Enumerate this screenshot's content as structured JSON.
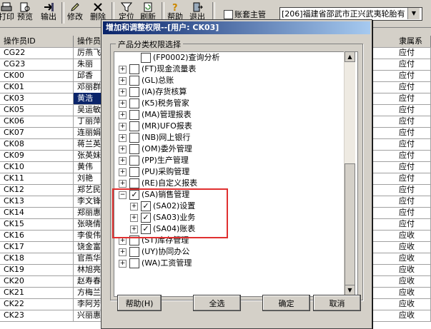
{
  "toolbar": {
    "buttons": [
      {
        "label": "打印",
        "icon": "print-icon"
      },
      {
        "label": "预览",
        "icon": "preview-icon"
      },
      {
        "label": "输出",
        "icon": "export-icon"
      },
      {
        "label": "修改",
        "icon": "edit-icon"
      },
      {
        "label": "删除",
        "icon": "delete-icon"
      },
      {
        "label": "定位",
        "icon": "filter-icon"
      },
      {
        "label": "刷新",
        "icon": "refresh-icon"
      },
      {
        "label": "帮助",
        "icon": "help-icon"
      },
      {
        "label": "退出",
        "icon": "exit-icon"
      }
    ],
    "account_checkbox_label": "账套主管",
    "company_select": "[206]福建省邵武市正兴武夷轮胎有"
  },
  "grid": {
    "headers": [
      "操作员ID",
      "操作员",
      "隶属系"
    ],
    "rows": [
      {
        "id": "CG22",
        "name": "厉燕飞",
        "dept": "应付"
      },
      {
        "id": "CG23",
        "name": "朱丽",
        "dept": "应付"
      },
      {
        "id": "CK00",
        "name": "邱香",
        "dept": "应付"
      },
      {
        "id": "CK01",
        "name": "邓丽群",
        "dept": "应付"
      },
      {
        "id": "CK03",
        "name": "黄浩",
        "dept": "应付"
      },
      {
        "id": "CK05",
        "name": "吴运敏",
        "dept": "应付"
      },
      {
        "id": "CK06",
        "name": "丁丽萍",
        "dept": "应付"
      },
      {
        "id": "CK07",
        "name": "连丽娟",
        "dept": "应付"
      },
      {
        "id": "CK08",
        "name": "蒋兰英",
        "dept": "应付"
      },
      {
        "id": "CK09",
        "name": "张英妹",
        "dept": "应付"
      },
      {
        "id": "CK10",
        "name": "黄伟",
        "dept": "应付"
      },
      {
        "id": "CK11",
        "name": "刘艳",
        "dept": "应付"
      },
      {
        "id": "CK12",
        "name": "郑艺民",
        "dept": "应付"
      },
      {
        "id": "CK13",
        "name": "李文锋",
        "dept": "应付"
      },
      {
        "id": "CK14",
        "name": "郑丽惠",
        "dept": "应付"
      },
      {
        "id": "CK15",
        "name": "张晓倩",
        "dept": "应付"
      },
      {
        "id": "CK16",
        "name": "李俊伟",
        "dept": "应收"
      },
      {
        "id": "CK17",
        "name": "饶金富",
        "dept": "应收"
      },
      {
        "id": "CK18",
        "name": "官燕华",
        "dept": "应收"
      },
      {
        "id": "CK19",
        "name": "林旭亮",
        "dept": "应收"
      },
      {
        "id": "CK20",
        "name": "赵寿春",
        "dept": "应收"
      },
      {
        "id": "CK21",
        "name": "方梅兰",
        "dept": "应收"
      },
      {
        "id": "CK22",
        "name": "李阿芳",
        "dept": "应收"
      },
      {
        "id": "CK23",
        "name": "兴丽惠",
        "dept": "应收"
      }
    ]
  },
  "dialog": {
    "title": "增加和调整权限--[用户: CK03]",
    "group_label": "产品分类权限选择",
    "tree": [
      {
        "label": "(FP0002)查询分析",
        "level": 2,
        "checked": false,
        "expander": false
      },
      {
        "label": "(FT)现金流量表",
        "level": 1,
        "checked": false,
        "expander": true
      },
      {
        "label": "(GL)总账",
        "level": 1,
        "checked": false,
        "expander": true
      },
      {
        "label": "(IA)存货核算",
        "level": 1,
        "checked": false,
        "expander": true
      },
      {
        "label": "(K5)税务管家",
        "level": 1,
        "checked": false,
        "expander": true
      },
      {
        "label": "(MA)管理报表",
        "level": 1,
        "checked": false,
        "expander": true
      },
      {
        "label": "(MR)UFO报表",
        "level": 1,
        "checked": false,
        "expander": true
      },
      {
        "label": "(NB)网上银行",
        "level": 1,
        "checked": false,
        "expander": true
      },
      {
        "label": "(OM)委外管理",
        "level": 1,
        "checked": false,
        "expander": true
      },
      {
        "label": "(PP)生产管理",
        "level": 1,
        "checked": false,
        "expander": true
      },
      {
        "label": "(PU)采购管理",
        "level": 1,
        "checked": false,
        "expander": true
      },
      {
        "label": "(RE)自定义报表",
        "level": 1,
        "checked": false,
        "expander": true
      },
      {
        "label": "(SA)销售管理",
        "level": 1,
        "checked": true,
        "expander": true,
        "expanded": true
      },
      {
        "label": "(SA02)设置",
        "level": 2,
        "checked": true,
        "expander": true
      },
      {
        "label": "(SA03)业务",
        "level": 2,
        "checked": true,
        "expander": true
      },
      {
        "label": "(SA04)账表",
        "level": 2,
        "checked": true,
        "expander": true
      },
      {
        "label": "(ST)库存管理",
        "level": 1,
        "checked": false,
        "expander": true
      },
      {
        "label": "(UY)协同办公",
        "level": 1,
        "checked": false,
        "expander": true
      },
      {
        "label": "(WA)工资管理",
        "level": 1,
        "checked": false,
        "expander": true
      }
    ],
    "buttons": {
      "help": "帮助(H)",
      "select_all": "全选",
      "ok": "确定",
      "cancel": "取消"
    }
  }
}
